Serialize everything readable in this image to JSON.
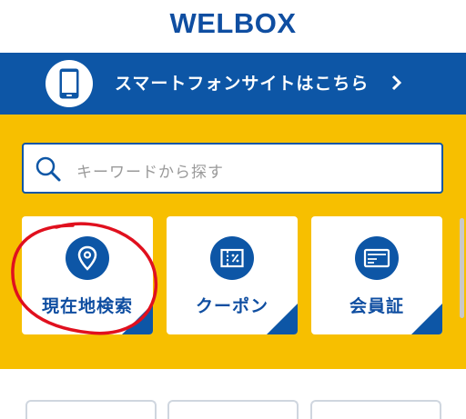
{
  "header": {
    "logo": "WELBOX"
  },
  "banner": {
    "label": "スマートフォンサイトはこちら",
    "icon": "smartphone-icon",
    "chevron": "chevron-right-icon"
  },
  "search": {
    "placeholder": "キーワードから探す",
    "icon": "search-icon"
  },
  "tiles": [
    {
      "label": "現在地検索",
      "icon": "location-pin-icon"
    },
    {
      "label": "クーポン",
      "icon": "coupon-icon"
    },
    {
      "label": "会員証",
      "icon": "membership-card-icon"
    }
  ],
  "colors": {
    "brand_blue": "#0d56a6",
    "accent_yellow": "#f7bf00",
    "annotation_red": "#e0101e"
  }
}
